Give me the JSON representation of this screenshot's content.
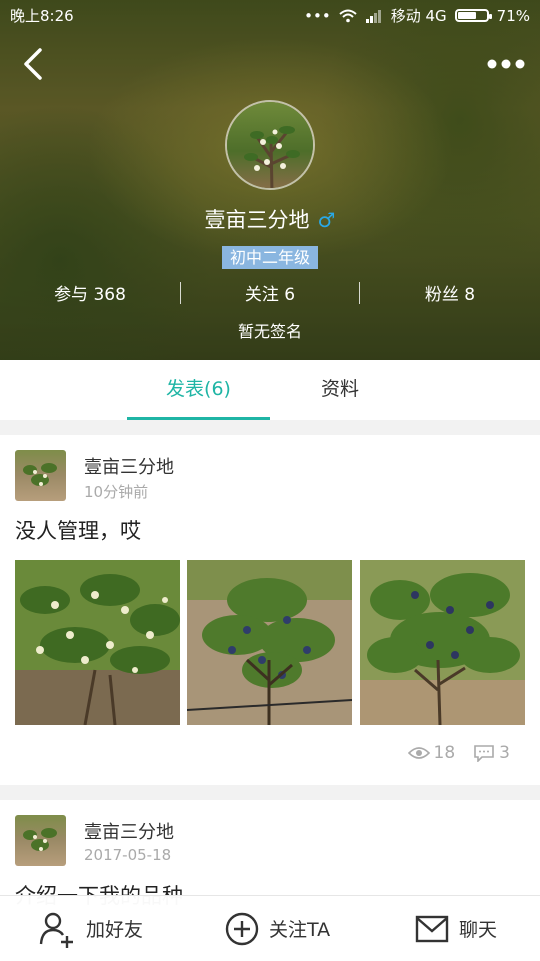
{
  "status_bar": {
    "time": "晚上8:26",
    "carrier": "移动 4G",
    "battery": "71%",
    "battery_level": 0.71
  },
  "header": {
    "back_icon": "chevron-left-icon",
    "more_icon": "more-dots-icon"
  },
  "profile": {
    "name": "壹亩三分地",
    "gender_symbol": "♂",
    "level": "初中二年级",
    "stats": {
      "participate": "参与 368",
      "following": "关注 6",
      "followers": "粉丝 8"
    },
    "signature": "暂无签名"
  },
  "tabs": [
    {
      "label": "发表(6)"
    },
    {
      "label": "资料"
    }
  ],
  "posts": [
    {
      "author": "壹亩三分地",
      "time": "10分钟前",
      "text": "没人管理，哎",
      "views": "18",
      "comments": "3"
    },
    {
      "author": "壹亩三分地",
      "time": "2017-05-18",
      "text": "介绍一下我的品种"
    }
  ],
  "bottom_bar": {
    "add_friend": "加好友",
    "follow": "关注TA",
    "chat": "聊天"
  },
  "colors": {
    "accent": "#1fb5a5",
    "gender": "#29a9e8",
    "level_bg": "#8ab6e0"
  }
}
